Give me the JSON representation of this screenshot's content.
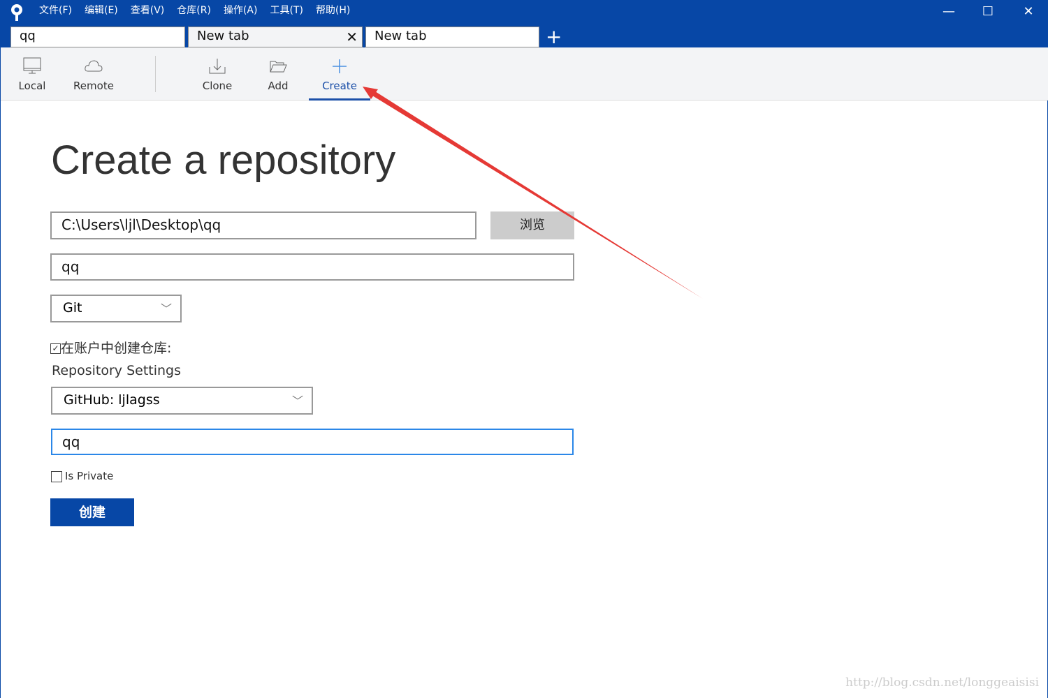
{
  "menu": [
    "文件(F)",
    "编辑(E)",
    "查看(V)",
    "仓库(R)",
    "操作(A)",
    "工具(T)",
    "帮助(H)"
  ],
  "tabs": [
    {
      "label": "qq"
    },
    {
      "label": "New tab"
    },
    {
      "label": "New tab"
    }
  ],
  "toolbar": {
    "local": "Local",
    "remote": "Remote",
    "clone": "Clone",
    "add": "Add",
    "create": "Create"
  },
  "page": {
    "title": "Create a repository",
    "path": "C:\\Users\\ljl\\Desktop\\qq",
    "browse": "浏览",
    "name": "qq",
    "vcs": "Git",
    "create_in_account": "在账户中创建仓库:",
    "create_in_account_checked": true,
    "settings_label": "Repository Settings",
    "account": "GitHub: ljlagss",
    "remote_name": "qq",
    "is_private": "Is Private",
    "is_private_checked": false,
    "create_button": "创建"
  },
  "accent": "#0747a6",
  "annotation_color": "#e53935",
  "watermark": "http://blog.csdn.net/longgeaisisi"
}
